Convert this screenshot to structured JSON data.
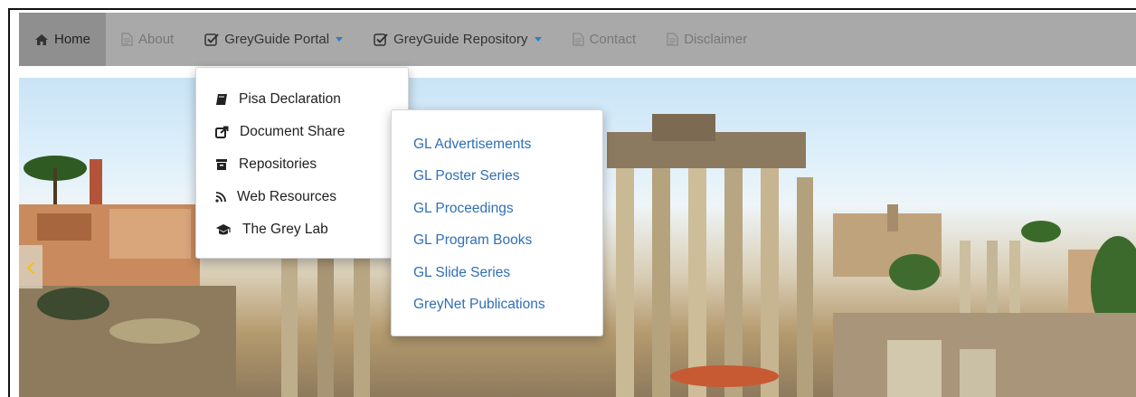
{
  "nav": {
    "home": "Home",
    "about": "About",
    "portal": "GreyGuide Portal",
    "repository": "GreyGuide Repository",
    "contact": "Contact",
    "disclaimer": "Disclaimer"
  },
  "portal_menu": {
    "items": [
      {
        "label": "Pisa Declaration",
        "icon": "book-icon"
      },
      {
        "label": "Document Share",
        "icon": "share-icon"
      },
      {
        "label": "Repositories",
        "icon": "archive-icon"
      },
      {
        "label": "Web Resources",
        "icon": "rss-icon"
      },
      {
        "label": "The Grey Lab",
        "icon": "graduation-cap-icon"
      }
    ]
  },
  "repository_menu": {
    "items": [
      "GL Advertisements",
      "GL Poster Series",
      "GL Proceedings",
      "GL Program Books",
      "GL Slide Series",
      "GreyNet Publications"
    ]
  },
  "carousel": {
    "prev_glyph": "‹"
  },
  "colors": {
    "navbar": "#a9a9a9",
    "active_tab": "#8f8f8f",
    "link": "#2f6fb6",
    "caret": "#2f7cc9",
    "carousel_arrow": "#f2c01e"
  }
}
